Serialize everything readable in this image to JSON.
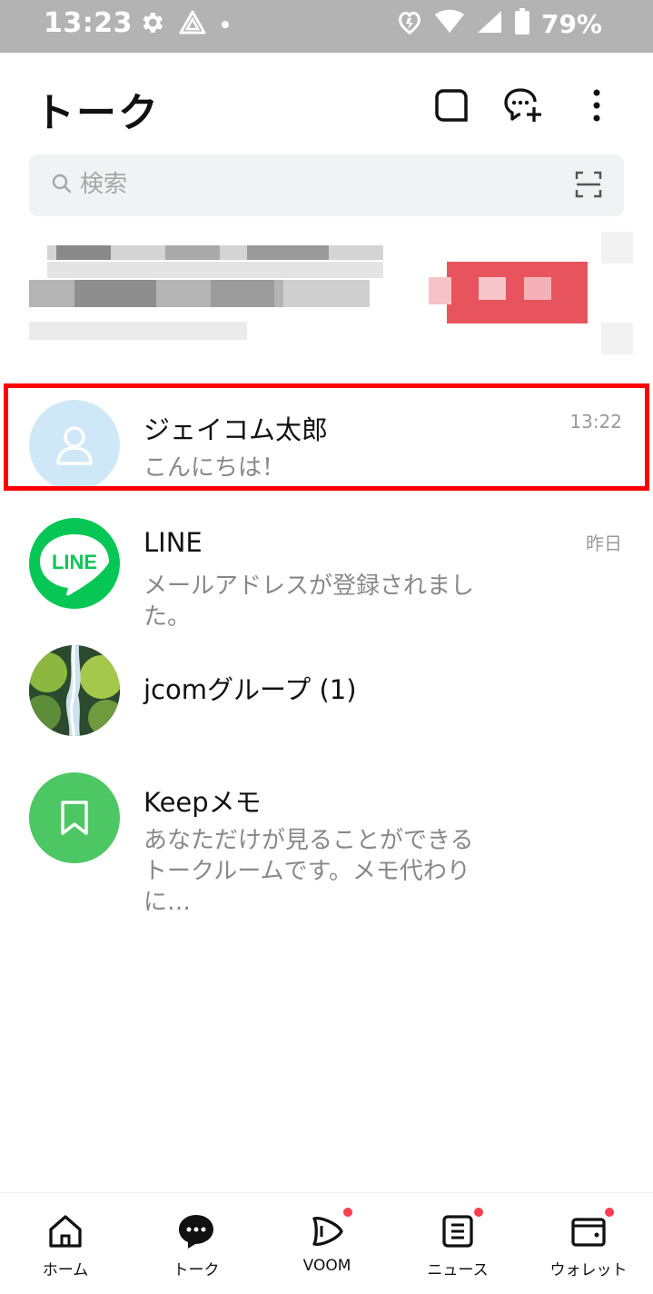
{
  "status_bar": {
    "time": "13:23",
    "battery": "79%"
  },
  "header": {
    "title": "トーク"
  },
  "search": {
    "placeholder": "検索"
  },
  "chats": [
    {
      "name": "ジェイコム太郎",
      "preview": "こんにちは！",
      "time": "13:22",
      "avatar": "person-icon"
    },
    {
      "name": "LINE",
      "preview": "メールアドレスが登録されました。",
      "time": "昨日",
      "avatar": "line-logo",
      "avatar_text": "LINE"
    },
    {
      "name": "jcomグループ (1)",
      "preview": "",
      "time": "",
      "avatar": "waterfall-photo"
    },
    {
      "name": "Keepメモ",
      "preview": "あなただけが見ることができるトークルームです。メモ代わりに…",
      "time": "",
      "avatar": "bookmark-icon"
    }
  ],
  "tabs": [
    {
      "label": "ホーム",
      "icon": "home-icon",
      "badge": false
    },
    {
      "label": "トーク",
      "icon": "chat-bubble-icon",
      "badge": false
    },
    {
      "label": "VOOM",
      "icon": "voom-icon",
      "badge": true
    },
    {
      "label": "ニュース",
      "icon": "news-icon",
      "badge": true
    },
    {
      "label": "ウォレット",
      "icon": "wallet-icon",
      "badge": true
    }
  ],
  "colors": {
    "line_green": "#06c755",
    "keep_green": "#4cc764",
    "highlight": "#ff0000",
    "badge": "#ff3b4e"
  }
}
